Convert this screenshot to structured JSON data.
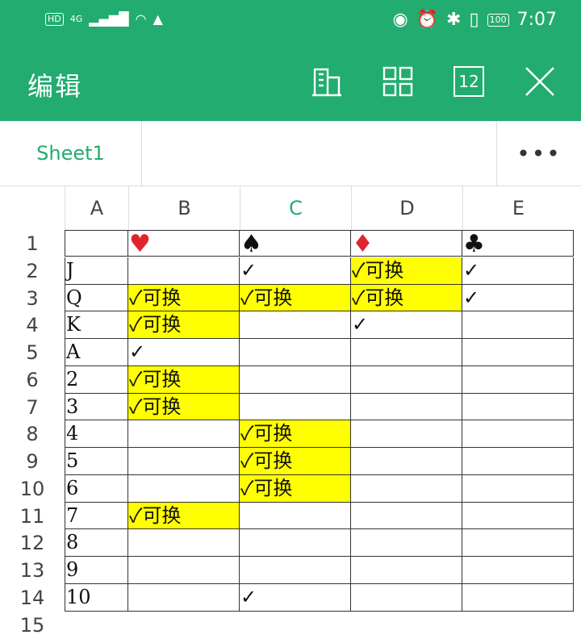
{
  "status_bar": {
    "left_badge": "HD",
    "network": "4G",
    "battery": "100",
    "time": "7:07"
  },
  "appbar": {
    "title": "编辑",
    "icons": [
      "building-icon",
      "grid-icon",
      "calendar-12-icon",
      "close-icon"
    ],
    "calendar_label": "12"
  },
  "tabs": {
    "sheet": "Sheet1",
    "more": "•••"
  },
  "columns": [
    "A",
    "B",
    "C",
    "D",
    "E"
  ],
  "selected_column": "C",
  "rows": [
    "1",
    "2",
    "3",
    "4",
    "5",
    "6",
    "7",
    "8",
    "9",
    "10",
    "11",
    "12",
    "13",
    "14",
    "15"
  ],
  "suits": {
    "B": "♥",
    "C": "♠",
    "D": "♦",
    "E": "♣"
  },
  "cells": {
    "A2": "J",
    "A3": "Q",
    "A4": "K",
    "A5": "A",
    "A6": "2",
    "A7": "3",
    "A8": "4",
    "A9": "5",
    "A10": "6",
    "A11": "7",
    "A12": "8",
    "A13": "9",
    "A14": "10",
    "B3": "✓可换",
    "B4": "✓可换",
    "B5": "✓",
    "B6": "✓可换",
    "B7": "✓可换",
    "B11": "✓可换",
    "C2": "✓",
    "C3": "✓可换",
    "C8": "✓可换",
    "C9": "✓可换",
    "C10": "✓可换",
    "C14": "✓",
    "D2": "✓可换",
    "D3": "✓可换",
    "D4": "✓",
    "E2": "✓",
    "E3": "✓"
  },
  "highlighted_cells": [
    "B3",
    "B4",
    "B6",
    "B7",
    "B11",
    "C3",
    "C8",
    "C9",
    "C10",
    "D2",
    "D3"
  ],
  "colors": {
    "accent": "#22ac70",
    "highlight": "#ffff00",
    "heart": "#e0242e"
  }
}
